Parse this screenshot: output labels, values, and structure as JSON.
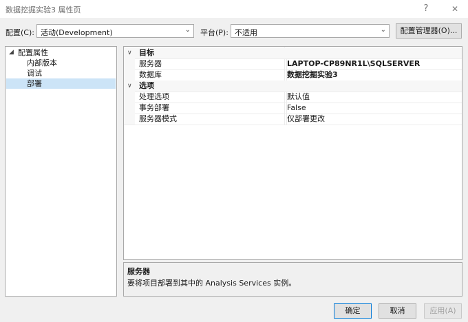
{
  "window": {
    "title": "数据挖掘实验3 属性页",
    "help_glyph": "?",
    "close_glyph": "✕"
  },
  "toolbar": {
    "config_label": "配置(C):",
    "config_value": "活动(Development)",
    "platform_label": "平台(P):",
    "platform_value": "不适用",
    "config_manager_label": "配置管理器(O)..."
  },
  "tree": {
    "root": "配置属性",
    "root_expander": "◢",
    "items": [
      "内部版本",
      "调试",
      "部署"
    ],
    "selected": "部署"
  },
  "grid": {
    "categories": [
      {
        "name": "目标",
        "properties": [
          {
            "name": "服务器",
            "value": "LAPTOP-CP89NR1L\\SQLSERVER",
            "bold": true
          },
          {
            "name": "数据库",
            "value": "数据挖掘实验3",
            "bold": true
          }
        ]
      },
      {
        "name": "选项",
        "properties": [
          {
            "name": "处理选项",
            "value": "默认值",
            "bold": false
          },
          {
            "name": "事务部署",
            "value": "False",
            "bold": false
          },
          {
            "name": "服务器模式",
            "value": "仅部署更改",
            "bold": false
          }
        ]
      }
    ]
  },
  "description": {
    "title": "服务器",
    "text": "要将项目部署到其中的 Analysis Services 实例。"
  },
  "buttons": {
    "ok": "确定",
    "cancel": "取消",
    "apply": "应用(A)"
  },
  "colors": {
    "selection": "#cce4f7",
    "accent": "#0078d7"
  }
}
